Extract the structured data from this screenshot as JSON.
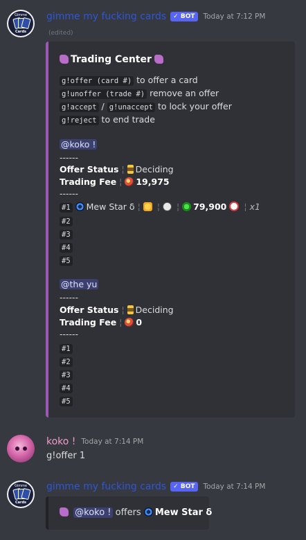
{
  "messages": {
    "m1": {
      "username": "gimme my fucking cards",
      "badge": "✓ BOT",
      "timestamp": "Today at 7:12 PM",
      "edited": "(edited)",
      "avatar_top": "Gimme",
      "avatar_bottom": "Cards",
      "embed": {
        "title": "Trading Center",
        "commands": [
          {
            "code": "g!offer (card #)",
            "text": " to offer a card"
          },
          {
            "code": "g!unoffer (trade #)",
            "text": " remove an offer"
          },
          {
            "code": "g!accept",
            "sep": " / ",
            "code2": "g!unaccept",
            "text": " to lock your offer"
          },
          {
            "code": "g!reject",
            "text": " to end trade"
          }
        ],
        "player1": {
          "mention": "@koko !",
          "divider": "------",
          "status_label": "Offer Status",
          "status_value": "Deciding",
          "fee_label": "Trading Fee",
          "fee_value": "19,975",
          "divider2": "------",
          "slot1_card": "Mew Star δ",
          "slot1_price": "79,900",
          "slot1_qty": "x1",
          "slots": [
            "#1",
            "#2",
            "#3",
            "#4",
            "#5"
          ]
        },
        "player2": {
          "mention": "@the yu",
          "divider": "------",
          "status_label": "Offer Status",
          "status_value": "Deciding",
          "fee_label": "Trading Fee",
          "fee_value": "0",
          "divider2": "------",
          "slots": [
            "#1",
            "#2",
            "#3",
            "#4",
            "#5"
          ]
        },
        "sep": "¦"
      }
    },
    "m2": {
      "username": "koko !",
      "timestamp": "Today at 7:14 PM",
      "text": "g!offer 1"
    },
    "m3": {
      "username": "gimme my fucking cards",
      "badge": "✓ BOT",
      "timestamp": "Today at 7:14 PM",
      "avatar_top": "Gimme",
      "avatar_bottom": "Cards",
      "embed": {
        "mention": "@koko !",
        "text": " offers ",
        "card": "Mew Star δ"
      }
    }
  },
  "colors": {
    "background": "#36393f",
    "embed_bg": "#2f3136",
    "embed_accent": "#9b59b6",
    "bot_name": "#2e56d6",
    "koko_name": "#f19cc7",
    "badge": "#5865f2"
  }
}
